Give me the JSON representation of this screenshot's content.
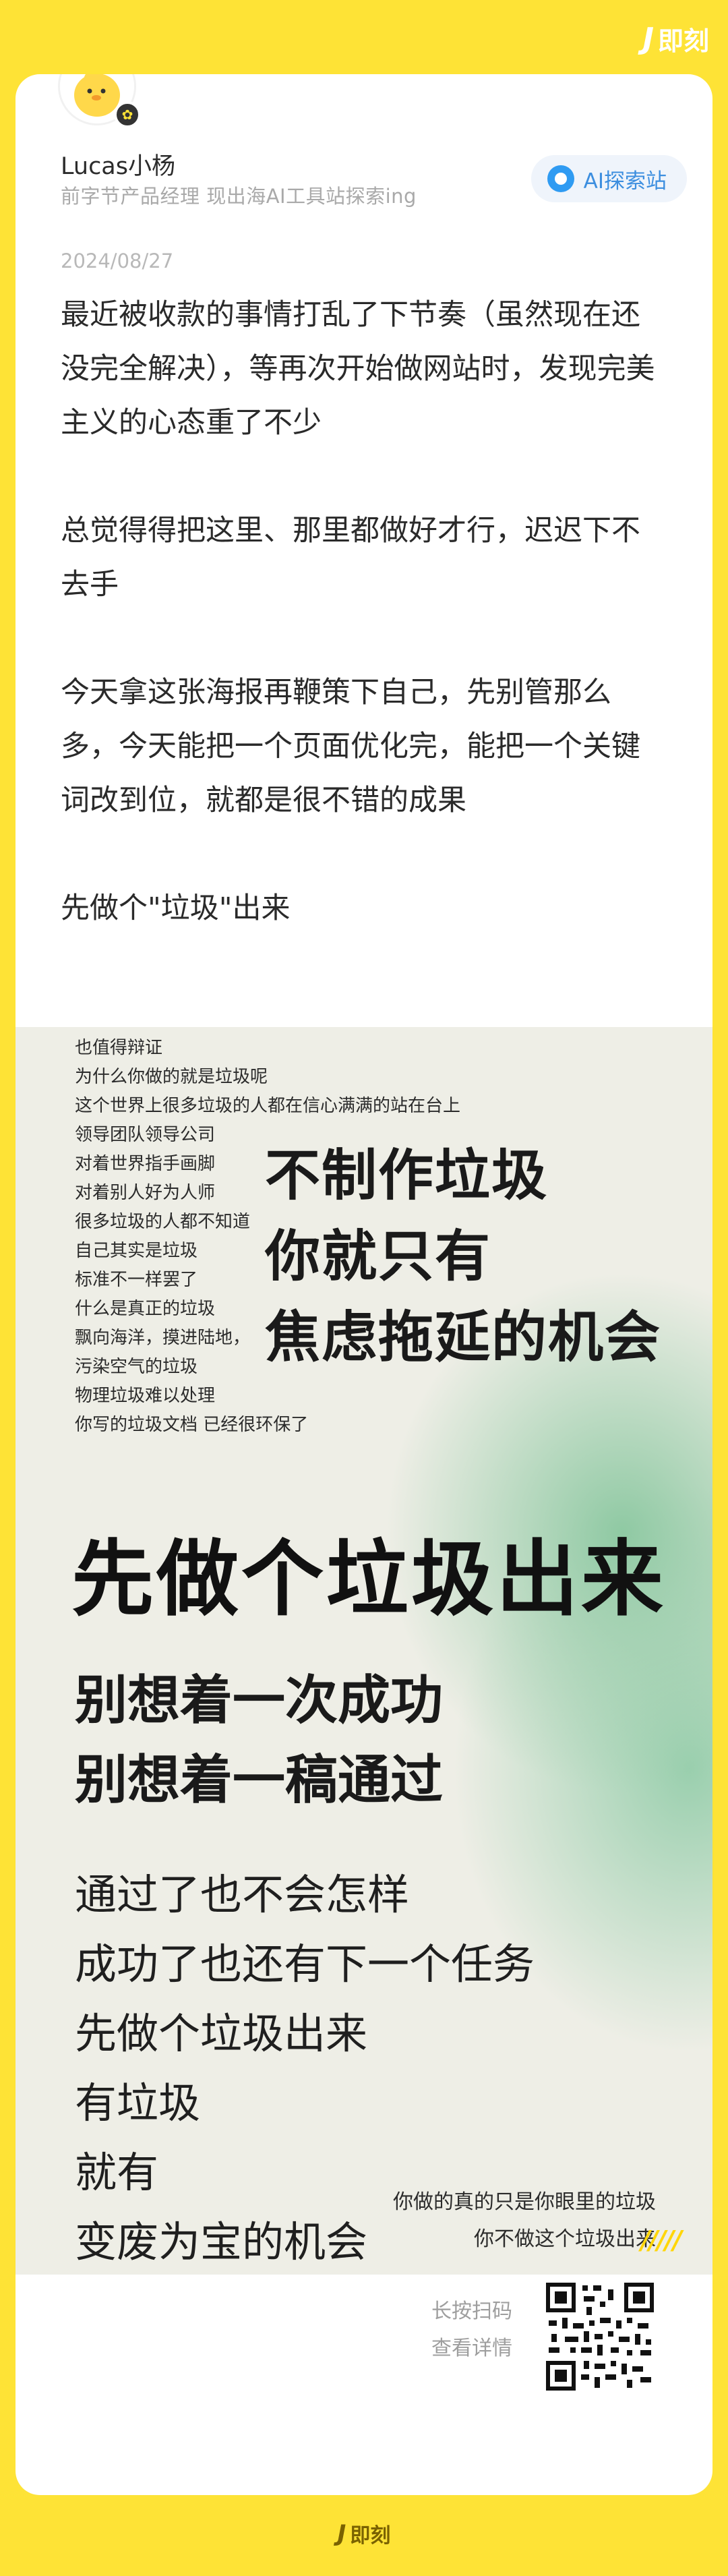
{
  "brand": {
    "name": "即刻"
  },
  "author": {
    "name": "Lucas小杨",
    "bio": "前字节产品经理 现出海AI工具站探索ing"
  },
  "topic": {
    "label": "AI探索站"
  },
  "post": {
    "date": "2024/08/27",
    "paragraphs": [
      "最近被收款的事情打乱了下节奏（虽然现在还没完全解决），等再次开始做网站时，发现完美主义的心态重了不少",
      "总觉得得把这里、那里都做好才行，迟迟下不去手",
      "今天拿这张海报再鞭策下自己，先别管那么多，今天能把一个页面优化完，能把一个关键词改到位，就都是很不错的成果",
      "先做个\"垃圾\"出来"
    ]
  },
  "poster": {
    "small_lines": [
      "也值得辩证",
      "为什么你做的就是垃圾呢",
      "这个世界上很多垃圾的人都在信心满满的站在台上",
      "领导团队领导公司",
      "对着世界指手画脚",
      "对着别人好为人师",
      "很多垃圾的人都不知道",
      "自己其实是垃圾",
      "标准不一样罢了",
      "什么是真正的垃圾",
      "飘向海洋，摸进陆地，",
      "污染空气的垃圾",
      "物理垃圾难以处理",
      "你写的垃圾文档 已经很环保了"
    ],
    "big_lines": [
      "不制作垃圾",
      "你就只有",
      "焦虑拖延的机会"
    ],
    "headline": "先做个垃圾出来",
    "medium_lines": [
      "别想着一次成功",
      "别想着一稿通过"
    ],
    "body_lines": [
      "通过了也不会怎样",
      "成功了也还有下一个任务",
      "先做个垃圾出来",
      "有垃圾",
      "就有",
      "变废为宝的机会"
    ],
    "corner_lines": [
      "你做的真的只是你眼里的垃圾",
      "你不做这个垃圾出来"
    ]
  },
  "footer": {
    "decoration": "/////",
    "scan_lines": [
      "长按扫码",
      "查看详情"
    ],
    "qr_icon": "qr-code-icon"
  },
  "colors": {
    "background": "#FEE336",
    "topic_accent": "#3C8EDF"
  }
}
